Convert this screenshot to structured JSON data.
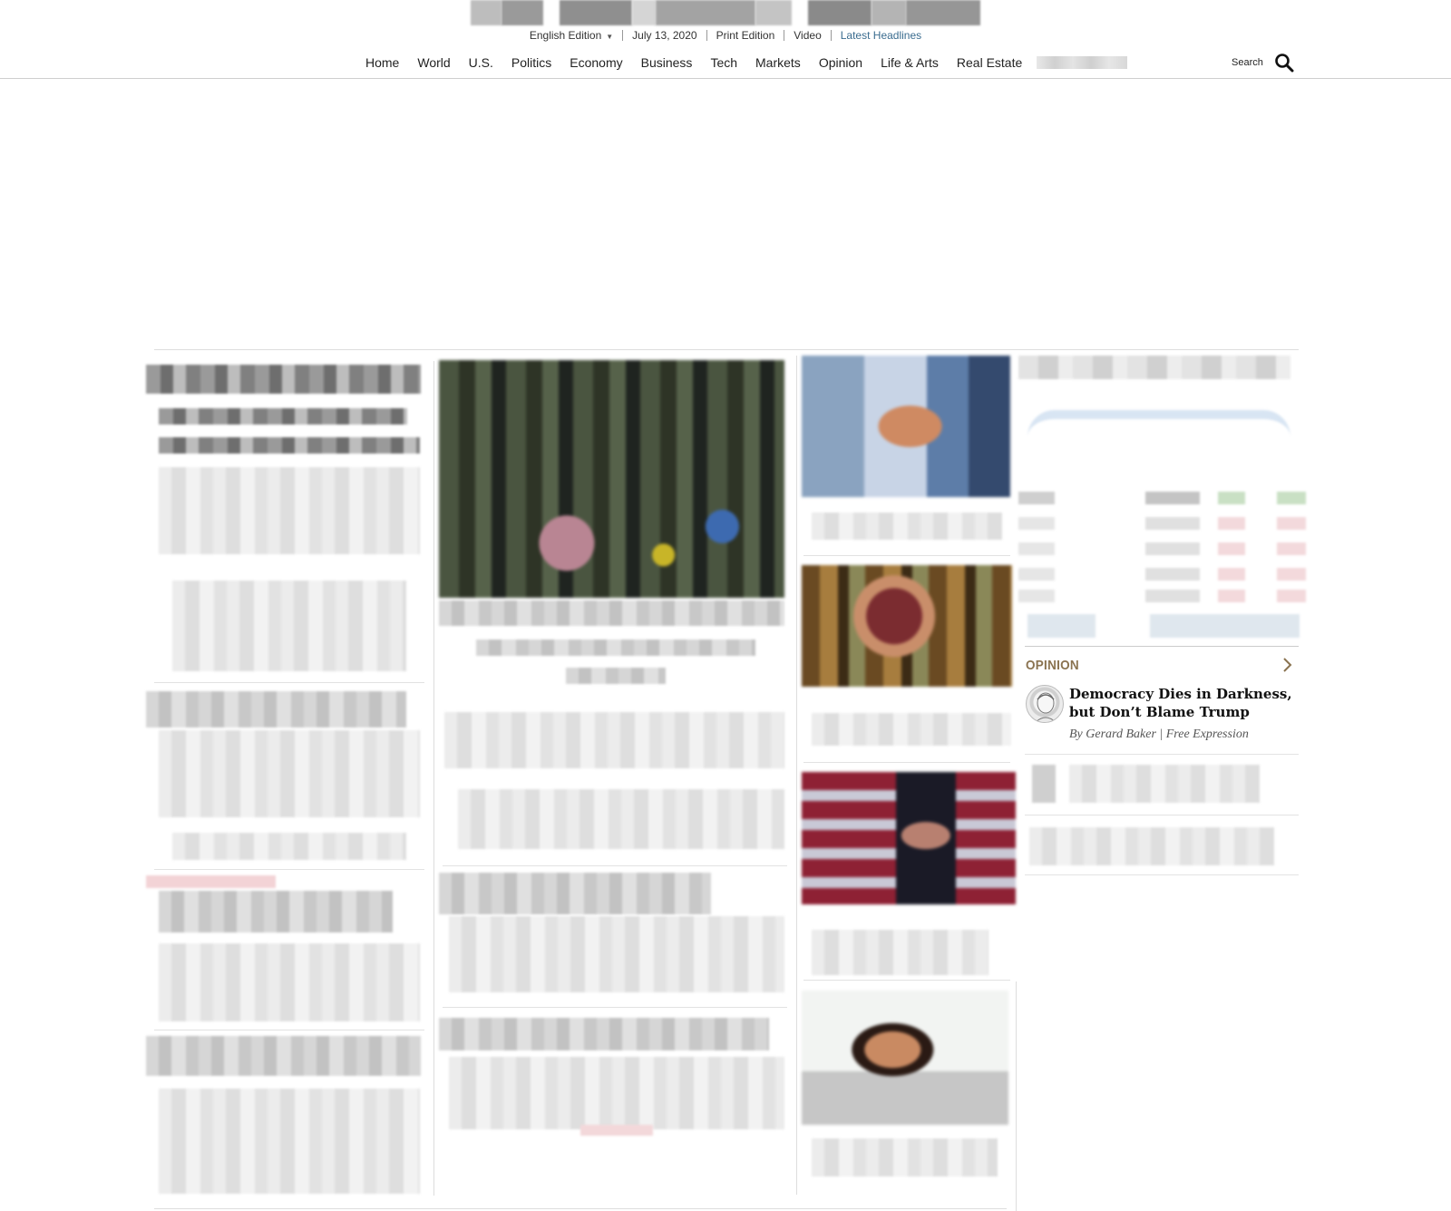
{
  "edition_bar": {
    "edition": "English Edition",
    "date": "July 13, 2020",
    "print_edition": "Print Edition",
    "video": "Video",
    "latest_headlines": "Latest Headlines"
  },
  "nav": {
    "items": [
      "Home",
      "World",
      "U.S.",
      "Politics",
      "Economy",
      "Business",
      "Tech",
      "Markets",
      "Opinion",
      "Life & Arts",
      "Real Estate"
    ],
    "search_label": "Search"
  },
  "opinion": {
    "label": "OPINION",
    "article": {
      "title": "Democracy Dies in Darkness, but Don’t Blame Trump",
      "byline": "By Gerard Baker | Free Expression"
    }
  },
  "colors": {
    "accent_link": "#3a6c8f",
    "opinion_label": "#8a7350"
  }
}
